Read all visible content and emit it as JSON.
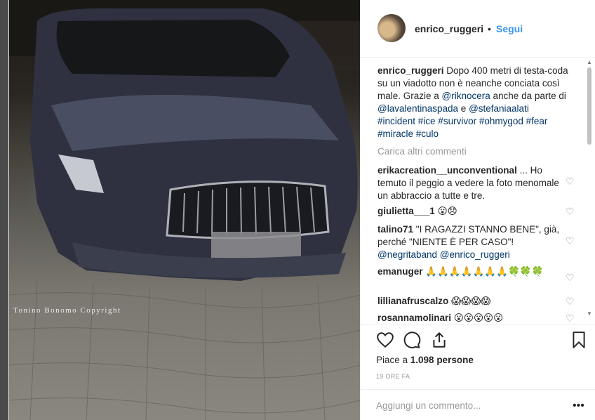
{
  "photo": {
    "copyright": "Tonino Bonomo Copyright"
  },
  "header": {
    "username": "enrico_ruggeri",
    "separator": "•",
    "follow": "Segui"
  },
  "caption": {
    "username": "enrico_ruggeri",
    "text1": "Dopo 400 metri di testa-coda su un viadotto non è neanche conciata così male. Grazie a ",
    "mention1": "@riknocera",
    "text2": " anche da parte di ",
    "mention2": "@lavalentinaspada",
    "text3": " e ",
    "mention3": "@stefaniaalati",
    "tags": "#incident #ice #survivor #ohmygod #fear #miracle #culo"
  },
  "load_more": "Carica altri commenti",
  "comments": [
    {
      "user": "erikacreation__unconventional",
      "text": "... Ho temuto il peggio a vedere la foto menomale un abbraccio a tutte e tre."
    },
    {
      "user": "giulietta___1",
      "text": "😮😞"
    },
    {
      "user": "talino71",
      "text": "\"I RAGAZZI STANNO BENE\", già, perché \"NIENTE È PER CASO\"!",
      "mention_a": "@negritaband",
      "mention_b": "@enrico_ruggeri"
    },
    {
      "user": "emanuger",
      "text": "🙏🙏🙏🙏🙏🙏🙏🍀🍀🍀"
    },
    {
      "user": "lillianafruscalzo",
      "text": "😱😱😱😱"
    },
    {
      "user": "rosannamolinari",
      "text": "😮😮😮😮😮"
    }
  ],
  "icons": {
    "heart": "heart-icon",
    "comment": "comment-icon",
    "share": "share-icon",
    "bookmark": "bookmark-icon"
  },
  "likes": {
    "prefix": "Piace a ",
    "count": "1.098 persone"
  },
  "timestamp": "19 ORE FA",
  "add_comment": {
    "placeholder": "Aggiungi un commento...",
    "more": "•••"
  },
  "colors": {
    "link": "#003569",
    "follow": "#3897f0",
    "muted": "#999999"
  }
}
